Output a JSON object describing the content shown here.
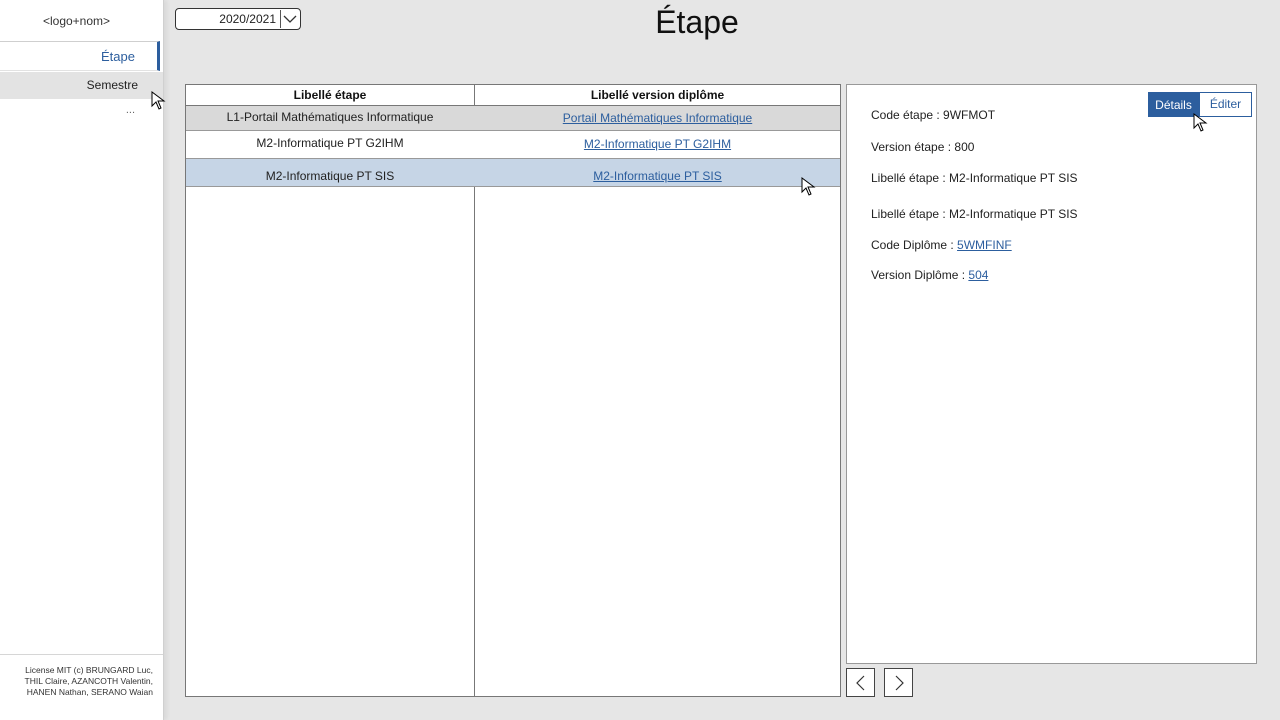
{
  "sidebar": {
    "logo": "<logo+nom>",
    "items": [
      {
        "label": "Étape",
        "active": true
      },
      {
        "label": "Semestre",
        "active": false
      },
      {
        "label": "..."
      }
    ],
    "license": "License MIT (c) BRUNGARD Luc, THIL Claire, AZANCOTH Valentin, HANEN Nathan, SERANO Waian"
  },
  "year_select": {
    "value": "2020/2021",
    "icon": "chevron-down-icon"
  },
  "page_title": "Étape",
  "table": {
    "headers": [
      "Libellé étape",
      "Libellé version diplôme"
    ],
    "rows": [
      {
        "etape": "L1-Portail Mathématiques Informatique",
        "version": "Portail Mathématiques Informatique",
        "state": "hovered"
      },
      {
        "etape": "M2-Informatique PT G2IHM",
        "version": "M2-Informatique PT G2IHM",
        "state": "normal"
      },
      {
        "etape": "M2-Informatique PT SIS",
        "version": "M2-Informatique PT SIS",
        "state": "selected"
      }
    ]
  },
  "details": {
    "tabs": {
      "details": "Détails",
      "editer": "Éditer",
      "active": "details"
    },
    "code_etape": "Code étape : 9WFMOT",
    "version_etape": "Version étape : 800",
    "libelle_etape_1": "Libellé étape : M2-Informatique PT SIS",
    "libelle_etape_2": "Libellé étape : M2-Informatique PT SIS",
    "code_diplome_label": "Code Diplôme : ",
    "code_diplome_value": "5WMFINF",
    "version_diplome_label": "Version Diplôme : ",
    "version_diplome_value": "504"
  },
  "pagination": {
    "prev_icon": "chevron-left-icon",
    "next_icon": "chevron-right-icon"
  },
  "colors": {
    "accent": "#2c5e9e",
    "selected_row": "#c6d5e6",
    "hovered_row": "#d9d9d9",
    "background": "#e6e6e6"
  }
}
